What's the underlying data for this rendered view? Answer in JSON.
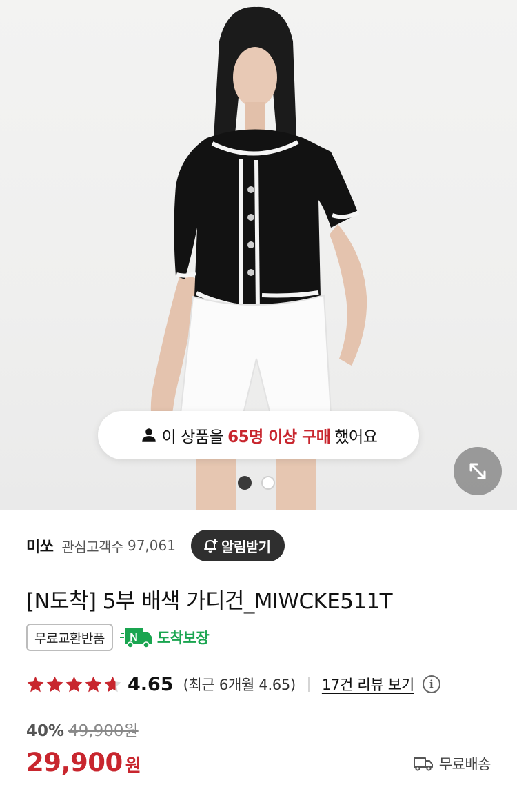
{
  "hero": {
    "banner": {
      "prefix": "이 상품을",
      "highlight": "65명 이상 구매",
      "suffix": "했어요"
    },
    "pager": {
      "current": 1,
      "total": 2
    }
  },
  "store": {
    "name": "미쏘",
    "fans_label": "관심고객수",
    "fans_count": "97,061",
    "alarm_label": "알림받기"
  },
  "product": {
    "title": "[N도착] 5부 배색 가디건_MIWCKE511T",
    "badge": "무료교환반품",
    "arrival_label": "도착보장",
    "rating": "4.65",
    "rating_value": 4.65,
    "recent_rating": "(최근 6개월 4.65)",
    "review_link": "17건 리뷰 보기",
    "discount": "40%",
    "original_price": "49,900원",
    "price": "29,900",
    "currency": "원",
    "shipping": "무료배송"
  },
  "colors": {
    "accent_red": "#c8262e",
    "arrival_green": "#1aa550",
    "dark_button": "#2f2f2f"
  }
}
